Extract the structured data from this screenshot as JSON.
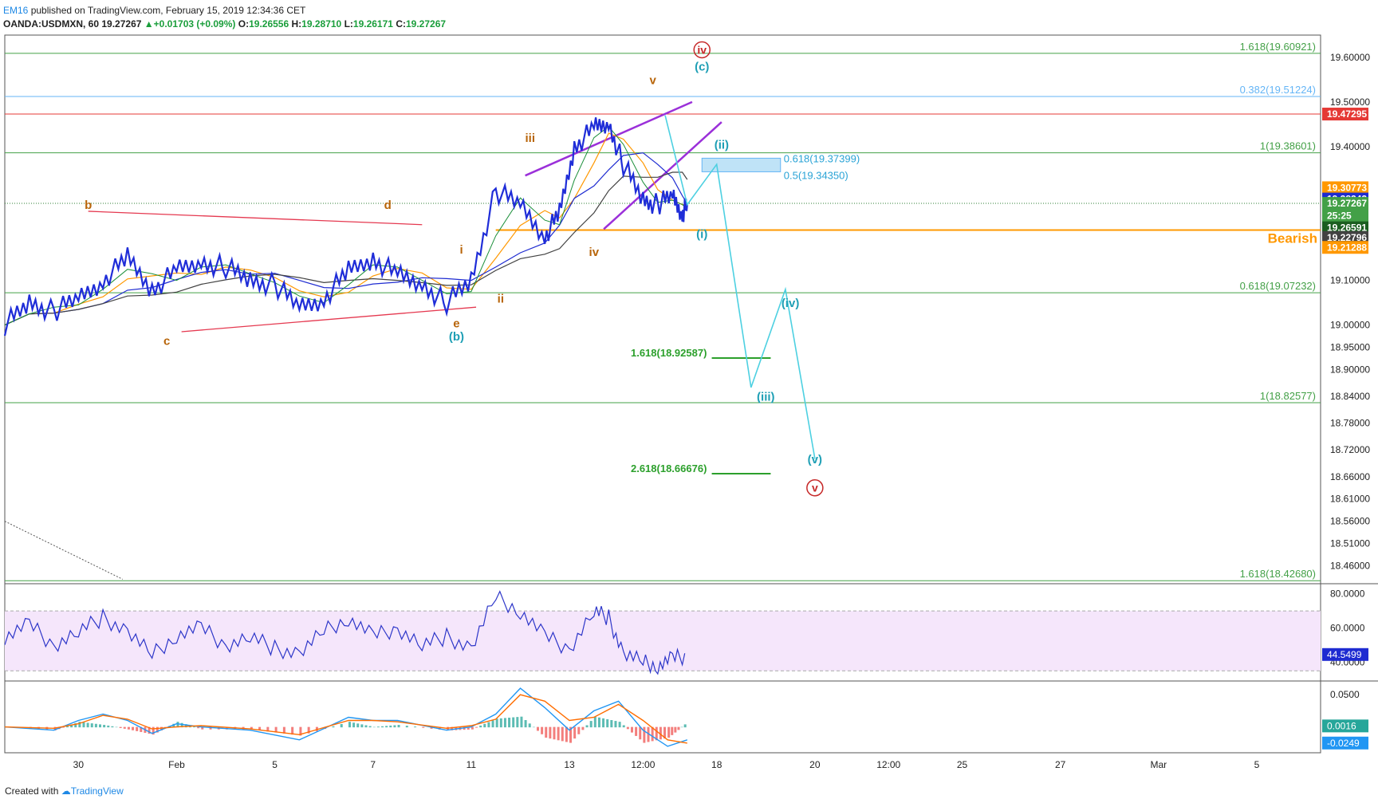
{
  "header": {
    "publisher": "EM16",
    "published_text": " published on TradingView.com, February 15, 2019 12:34:36 CET"
  },
  "symbol_line": {
    "symbol": "OANDA:USDMXN, 60",
    "last": "19.27267",
    "change": "+0.01703 (+0.09%)",
    "open_label": "O:",
    "open": "19.26556",
    "high_label": "H:",
    "high": "19.28710",
    "low_label": "L:",
    "low": "19.26171",
    "close_label": "C:",
    "close": "19.27267"
  },
  "footer": {
    "created_with": "Created with",
    "brand": "TradingView"
  },
  "chart_data": {
    "type": "line",
    "price_axis": {
      "ylim": [
        18.42,
        19.65
      ],
      "ticks": [
        "19.60000",
        "19.50000",
        "19.40000",
        "19.10000",
        "19.00000",
        "18.95000",
        "18.90000",
        "18.84000",
        "18.78000",
        "18.72000",
        "18.66000",
        "18.61000",
        "18.56000",
        "18.51000",
        "18.46000"
      ],
      "tick_values": [
        19.6,
        19.5,
        19.4,
        19.1,
        19.0,
        18.95,
        18.9,
        18.84,
        18.78,
        18.72,
        18.66,
        18.61,
        18.56,
        18.51,
        18.46
      ]
    },
    "time_axis": {
      "labels": [
        "30",
        "Feb",
        "5",
        "7",
        "11",
        "13",
        "12:00",
        "18",
        "20",
        "12:00",
        "25",
        "27",
        "Mar",
        "5"
      ],
      "days": [
        1.5,
        3.5,
        5.5,
        7.5,
        9.5,
        11.5,
        13,
        14.5,
        16.5,
        18,
        19.5,
        21.5,
        23.5,
        25.5
      ]
    },
    "price_series": {
      "x": [
        0,
        0.5,
        1,
        1.5,
        2,
        2.5,
        3,
        3.5,
        4,
        4.5,
        5,
        5.5,
        6,
        6.5,
        7,
        7.5,
        8,
        8.5,
        9,
        9.5,
        10,
        10.5,
        11,
        11.3,
        11.6,
        12,
        12.3,
        12.6,
        13,
        13.3,
        13.6,
        13.8,
        13.9
      ],
      "y": [
        19.0,
        19.05,
        19.03,
        19.06,
        19.1,
        19.15,
        19.08,
        19.12,
        19.14,
        19.13,
        19.1,
        19.09,
        19.04,
        19.06,
        19.12,
        19.15,
        19.11,
        19.09,
        19.05,
        19.1,
        19.3,
        19.27,
        19.2,
        19.25,
        19.4,
        19.44,
        19.45,
        19.36,
        19.28,
        19.27,
        19.29,
        19.25,
        19.27
      ]
    },
    "price_tags": [
      {
        "value": "19.47295",
        "price": 19.47295,
        "color": "#e53935"
      },
      {
        "value": "19.30773",
        "price": 19.30773,
        "color": "#ff9800"
      },
      {
        "value": "19.28242",
        "price": 19.28242,
        "color": "#1e2bd1"
      },
      {
        "value": "19.27267",
        "price": 19.27267,
        "color": "#43a047"
      },
      {
        "value": "25:25",
        "price": 19.245,
        "color": "#43a047"
      },
      {
        "value": "19.26591",
        "price": 19.218,
        "color": "#1b5e20"
      },
      {
        "value": "19.22796",
        "price": 19.196,
        "color": "#424242"
      },
      {
        "value": "19.21288",
        "price": 19.174,
        "color": "#ff9800"
      }
    ],
    "fib_levels": [
      {
        "label": "1.618(19.60921)",
        "price": 19.60921,
        "color": "#43a047"
      },
      {
        "label": "0.382(19.51224)",
        "price": 19.51224,
        "color": "#64b5f6"
      },
      {
        "label": "1(19.38601)",
        "price": 19.38601,
        "color": "#43a047"
      },
      {
        "label": "0.618(19.07232)",
        "price": 19.07232,
        "color": "#43a047"
      },
      {
        "label": "1(18.82577)",
        "price": 18.82577,
        "color": "#43a047"
      },
      {
        "label": "1.618(18.42680)",
        "price": 18.4268,
        "color": "#43a047"
      }
    ],
    "targets": [
      {
        "label": "1.618(18.92587)",
        "price": 18.92587
      },
      {
        "label": "2.618(18.66676)",
        "price": 18.66676
      }
    ],
    "retracement_box": {
      "upper_label": "0.618(19.37399)",
      "upper": 19.37399,
      "lower_label": "0.5(19.34350)",
      "lower": 19.3435
    },
    "resistance": {
      "price": 19.47295
    },
    "bearish": {
      "label": "Bearish",
      "price": 19.21288
    },
    "wave_labels": [
      {
        "text": "b",
        "day": 1.7,
        "price": 19.26,
        "color": "#b8650a"
      },
      {
        "text": "c",
        "day": 3.3,
        "price": 18.955,
        "color": "#b8650a"
      },
      {
        "text": "d",
        "day": 7.8,
        "price": 19.26,
        "color": "#b8650a"
      },
      {
        "text": "e",
        "day": 9.2,
        "price": 18.995,
        "color": "#b8650a"
      },
      {
        "text": "(b)",
        "day": 9.2,
        "price": 18.965,
        "color": "#1e9fb5"
      },
      {
        "text": "i",
        "day": 9.3,
        "price": 19.16,
        "color": "#b8650a"
      },
      {
        "text": "ii",
        "day": 10.1,
        "price": 19.05,
        "color": "#b8650a"
      },
      {
        "text": "iii",
        "day": 10.7,
        "price": 19.41,
        "color": "#b8650a"
      },
      {
        "text": "iv",
        "day": 12.0,
        "price": 19.155,
        "color": "#b8650a"
      },
      {
        "text": "v",
        "day": 13.2,
        "price": 19.54,
        "color": "#b8650a"
      },
      {
        "text": "(c)",
        "day": 14.2,
        "price": 19.57,
        "color": "#1e9fb5"
      },
      {
        "text": "(i)",
        "day": 14.2,
        "price": 19.195,
        "color": "#1e9fb5"
      },
      {
        "text": "(ii)",
        "day": 14.6,
        "price": 19.395,
        "color": "#1e9fb5"
      },
      {
        "text": "(iii)",
        "day": 15.5,
        "price": 18.83,
        "color": "#1e9fb5"
      },
      {
        "text": "(iv)",
        "day": 16.0,
        "price": 19.04,
        "color": "#1e9fb5"
      },
      {
        "text": "(v)",
        "day": 16.5,
        "price": 18.69,
        "color": "#1e9fb5"
      }
    ],
    "circled_labels": [
      {
        "text": "iv",
        "day": 14.2,
        "price": 19.617
      },
      {
        "text": "v",
        "day": 16.5,
        "price": 18.635
      }
    ],
    "projection": {
      "days": [
        13.45,
        13.9,
        14.5,
        15.2,
        15.9,
        16.5
      ],
      "prices": [
        19.47,
        19.27,
        19.36,
        18.86,
        19.08,
        18.7
      ]
    },
    "rsi": {
      "ylim": [
        30,
        85
      ],
      "ticks": [
        "80.0000",
        "60.0000",
        "40.0000"
      ],
      "tick_values": [
        80,
        60,
        40
      ],
      "band": [
        35,
        70
      ],
      "value_label": "44.5499",
      "value": 44.5499,
      "x": [
        0,
        0.5,
        1,
        1.5,
        2,
        2.5,
        3,
        3.5,
        4,
        4.5,
        5,
        5.5,
        6,
        6.5,
        7,
        7.5,
        8,
        8.5,
        9,
        9.5,
        10,
        10.5,
        11,
        11.5,
        12,
        12.3,
        12.6,
        13,
        13.3,
        13.6,
        13.9
      ],
      "y": [
        55,
        62,
        50,
        58,
        66,
        58,
        44,
        56,
        60,
        50,
        55,
        48,
        45,
        58,
        66,
        55,
        60,
        50,
        55,
        48,
        78,
        70,
        55,
        48,
        70,
        66,
        45,
        40,
        38,
        42,
        44
      ]
    },
    "macd": {
      "ylim": [
        -0.04,
        0.07
      ],
      "ticks": [
        "0.0500"
      ],
      "tick_values": [
        0.05
      ],
      "macd_label": "0.0016",
      "macd_value": 0.0016,
      "signal_label": "-0.0249",
      "signal_value": -0.0249,
      "x": [
        0,
        1,
        1.5,
        2,
        2.5,
        3,
        3.5,
        4,
        5,
        6,
        7,
        7.5,
        8,
        9,
        9.5,
        10,
        10.5,
        11,
        11.5,
        12,
        12.5,
        13,
        13.5,
        13.9
      ],
      "macd_line": [
        0,
        -0.005,
        0.01,
        0.02,
        0.01,
        -0.01,
        0.005,
        0,
        -0.005,
        -0.02,
        0.015,
        0.01,
        0.01,
        -0.005,
        0,
        0.02,
        0.06,
        0.03,
        -0.005,
        0.025,
        0.04,
        -0.005,
        -0.03,
        -0.02
      ],
      "signal_line": [
        0,
        -0.002,
        0.005,
        0.018,
        0.012,
        -0.003,
        0,
        0.002,
        -0.003,
        -0.012,
        0.01,
        0.01,
        0.008,
        -0.002,
        0.002,
        0.012,
        0.05,
        0.04,
        0.01,
        0.015,
        0.035,
        0.01,
        -0.02,
        -0.025
      ]
    }
  }
}
